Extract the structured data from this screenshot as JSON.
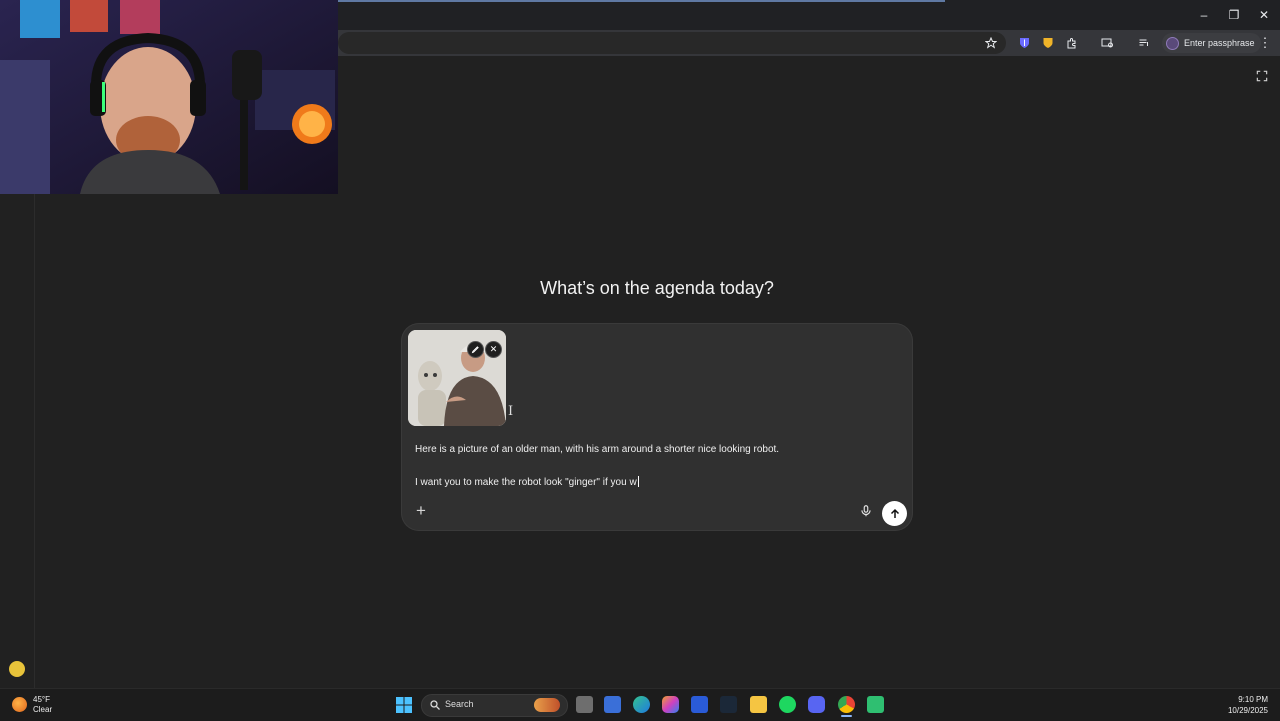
{
  "browser": {
    "window_controls": [
      "–",
      "❐",
      "✕"
    ],
    "passphrase_button": "Enter passphrase"
  },
  "main": {
    "heading": "What’s on the agenda today?"
  },
  "composer": {
    "attachment": {
      "edit_icon": "pencil-icon",
      "remove_icon": "close-icon"
    },
    "message_line_1": "Here is a picture of an older man, with his arm around a shorter nice looking robot.",
    "message_line_2": "I want you to make the robot look \"ginger\" if you w",
    "add_button": "+",
    "mic_icon": "microphone-icon",
    "send_icon": "arrow-up-icon"
  },
  "taskbar": {
    "weather_temp": "45°F",
    "weather_condition": "Clear",
    "search_label": "Search",
    "time": "9:10 PM",
    "date": "10/29/2025"
  },
  "colors": {
    "page_bg": "#212121",
    "composer_bg": "#303030",
    "send_bg": "#ffffff"
  }
}
